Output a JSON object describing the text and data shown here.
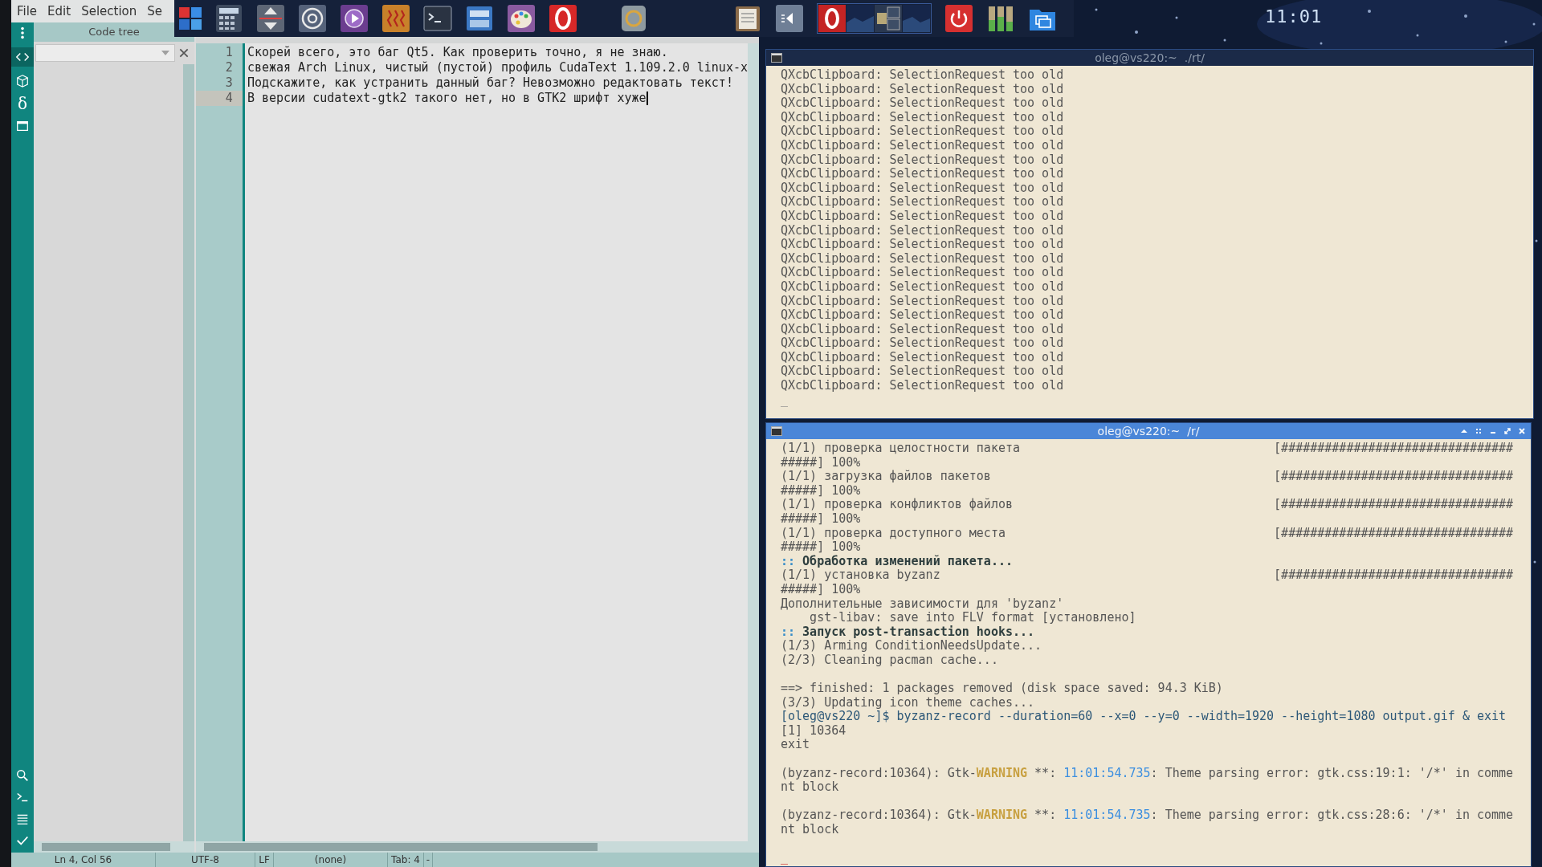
{
  "editor": {
    "menu": [
      "File",
      "Edit",
      "Selection",
      "Se"
    ],
    "side_toolbar": {
      "glyph": "δ"
    },
    "code_tree": {
      "title": "Code tree"
    },
    "lines": [
      {
        "number": "1",
        "text": "Скорей всего, это баг Qt5. Как проверить точно, я не знаю.",
        "current": false
      },
      {
        "number": "2",
        "text": "свежая Arch Linux, чистый (пустой) профиль CudaText 1.109.2.0 linux-x",
        "current": false
      },
      {
        "number": "3",
        "text": "Подскажите, как устранить данный баг? Невозможно редактовать текст!",
        "current": false
      },
      {
        "number": "4",
        "text": "В версии cudatext-gtk2 такого нет, но в GTK2 шрифт хуже",
        "current": true
      }
    ],
    "status_bar": [
      "Ln 4, Col 56",
      "UTF-8",
      "LF",
      "(none)",
      "Tab: 4",
      "-"
    ]
  },
  "panel": {
    "clock": "11:01"
  },
  "terminals": [
    {
      "title": "oleg@vs220:~  ./rt/",
      "active": false,
      "lines": [
        {
          "kind": "text",
          "text": "QXcbClipboard: SelectionRequest too old"
        },
        {
          "kind": "text",
          "text": "QXcbClipboard: SelectionRequest too old"
        },
        {
          "kind": "text",
          "text": "QXcbClipboard: SelectionRequest too old"
        },
        {
          "kind": "text",
          "text": "QXcbClipboard: SelectionRequest too old"
        },
        {
          "kind": "text",
          "text": "QXcbClipboard: SelectionRequest too old"
        },
        {
          "kind": "text",
          "text": "QXcbClipboard: SelectionRequest too old"
        },
        {
          "kind": "text",
          "text": "QXcbClipboard: SelectionRequest too old"
        },
        {
          "kind": "text",
          "text": "QXcbClipboard: SelectionRequest too old"
        },
        {
          "kind": "text",
          "text": "QXcbClipboard: SelectionRequest too old"
        },
        {
          "kind": "text",
          "text": "QXcbClipboard: SelectionRequest too old"
        },
        {
          "kind": "text",
          "text": "QXcbClipboard: SelectionRequest too old"
        },
        {
          "kind": "text",
          "text": "QXcbClipboard: SelectionRequest too old"
        },
        {
          "kind": "text",
          "text": "QXcbClipboard: SelectionRequest too old"
        },
        {
          "kind": "text",
          "text": "QXcbClipboard: SelectionRequest too old"
        },
        {
          "kind": "text",
          "text": "QXcbClipboard: SelectionRequest too old"
        },
        {
          "kind": "text",
          "text": "QXcbClipboard: SelectionRequest too old"
        },
        {
          "kind": "text",
          "text": "QXcbClipboard: SelectionRequest too old"
        },
        {
          "kind": "text",
          "text": "QXcbClipboard: SelectionRequest too old"
        },
        {
          "kind": "text",
          "text": "QXcbClipboard: SelectionRequest too old"
        },
        {
          "kind": "text",
          "text": "QXcbClipboard: SelectionRequest too old"
        },
        {
          "kind": "text",
          "text": "QXcbClipboard: SelectionRequest too old"
        },
        {
          "kind": "text",
          "text": "QXcbClipboard: SelectionRequest too old"
        },
        {
          "kind": "text",
          "text": "QXcbClipboard: SelectionRequest too old"
        },
        {
          "kind": "cursor",
          "text": "_"
        }
      ]
    },
    {
      "title": "oleg@vs220:~  /r/",
      "active": true,
      "lines": [
        {
          "kind": "progress",
          "text": "(1/1) проверка целостности пакета",
          "bar": "[################################"
        },
        {
          "kind": "text",
          "text": "#####] 100%"
        },
        {
          "kind": "progress",
          "text": "(1/1) загрузка файлов пакетов",
          "bar": "[################################"
        },
        {
          "kind": "text",
          "text": "#####] 100%"
        },
        {
          "kind": "progress",
          "text": "(1/1) проверка конфликтов файлов",
          "bar": "[################################"
        },
        {
          "kind": "text",
          "text": "#####] 100%"
        },
        {
          "kind": "progress",
          "text": "(1/1) проверка доступного места",
          "bar": "[################################"
        },
        {
          "kind": "text",
          "text": "#####] 100%"
        },
        {
          "kind": "rich",
          "segments": [
            {
              "text": "::",
              "kind": "accent"
            },
            {
              "text": " Обработка изменений пакета...",
              "kind": "bold"
            }
          ]
        },
        {
          "kind": "progress",
          "text": "(1/1) установка byzanz",
          "bar": "[################################"
        },
        {
          "kind": "text",
          "text": "#####] 100%"
        },
        {
          "kind": "text",
          "text": "Дополнительные зависимости для 'byzanz'"
        },
        {
          "kind": "text",
          "text": "    gst-libav: save into FLV format [установлено]"
        },
        {
          "kind": "rich",
          "segments": [
            {
              "text": "::",
              "kind": "accent"
            },
            {
              "text": " Запуск post-transaction hooks...",
              "kind": "bold"
            }
          ]
        },
        {
          "kind": "text",
          "text": "(1/3) Arming ConditionNeedsUpdate..."
        },
        {
          "kind": "text",
          "text": "(2/3) Cleaning pacman cache..."
        },
        {
          "kind": "blank"
        },
        {
          "kind": "text",
          "text": "==> finished: 1 packages removed (disk space saved: 94.3 KiB)"
        },
        {
          "kind": "text",
          "text": "(3/3) Updating icon theme caches..."
        },
        {
          "kind": "rich",
          "segments": [
            {
              "text": "[oleg@vs220 ~]$ byzanz-record --duration=60 --x=0 --y=0 --width=1920 --height=1080 output.gif & exit",
              "kind": "prompt"
            }
          ]
        },
        {
          "kind": "text",
          "text": "[1] 10364"
        },
        {
          "kind": "text",
          "text": "exit"
        },
        {
          "kind": "blank"
        },
        {
          "kind": "rich",
          "segments": [
            {
              "text": "(byzanz-record:10364): Gtk-",
              "kind": "plain"
            },
            {
              "text": "WARNING",
              "kind": "warning"
            },
            {
              "text": " **: ",
              "kind": "plain"
            },
            {
              "text": "11:01:54.735",
              "kind": "time"
            },
            {
              "text": ": Theme parsing error: gtk.css:19:1: '/*' in comme",
              "kind": "plain"
            }
          ]
        },
        {
          "kind": "text",
          "text": "nt block"
        },
        {
          "kind": "blank"
        },
        {
          "kind": "rich",
          "segments": [
            {
              "text": "(byzanz-record:10364): Gtk-",
              "kind": "plain"
            },
            {
              "text": "WARNING",
              "kind": "warning"
            },
            {
              "text": " **: ",
              "kind": "plain"
            },
            {
              "text": "11:01:54.735",
              "kind": "time"
            },
            {
              "text": ": Theme parsing error: gtk.css:28:6: '/*' in comme",
              "kind": "plain"
            }
          ]
        },
        {
          "kind": "text",
          "text": "nt block"
        },
        {
          "kind": "blank"
        },
        {
          "kind": "cursor",
          "text": "_"
        }
      ]
    }
  ]
}
